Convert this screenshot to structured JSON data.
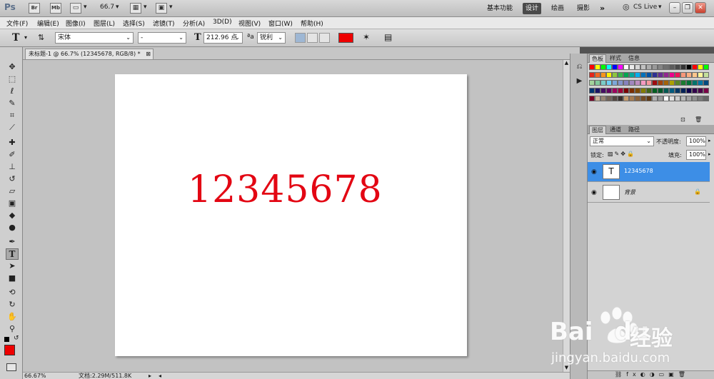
{
  "appbar": {
    "logo": "Ps",
    "bridge_icon": "Br",
    "minibridge_icon": "Mb",
    "zoom": "66.7",
    "workspaces": [
      "基本功能",
      "设计",
      "绘画",
      "摄影"
    ],
    "active_workspace": "设计",
    "more_label": "»",
    "cslive_label": "CS Live"
  },
  "menu": [
    "文件(F)",
    "编辑(E)",
    "图像(I)",
    "图层(L)",
    "选择(S)",
    "滤镜(T)",
    "分析(A)",
    "3D(D)",
    "视图(V)",
    "窗口(W)",
    "帮助(H)"
  ],
  "options": {
    "font_family": "宋体",
    "font_style": "-",
    "font_size": "212.96 点",
    "antialias_label": "ªa",
    "antialias": "锐利",
    "text_color": "#ee0000"
  },
  "document": {
    "tab_title": "未标题-1 @ 66.7% (12345678, RGB/8) *",
    "canvas_text": "12345678",
    "canvas_text_color": "#e30613",
    "status_zoom": "66.67%",
    "status_doc": "文档:2.29M/511.8K"
  },
  "panels": {
    "color_tabs": [
      "色板",
      "样式",
      "信息"
    ],
    "layers_tabs": [
      "图层",
      "通道",
      "路径"
    ],
    "blend_mode": "正常",
    "opacity_label": "不透明度:",
    "opacity": "100%",
    "lock_label": "锁定:",
    "fill_label": "填充:",
    "fill": "100%",
    "layers": [
      {
        "name": "12345678",
        "thumb": "T",
        "selected": true
      },
      {
        "name": "背景",
        "thumb": "",
        "selected": false
      }
    ]
  },
  "swatch_colors": [
    "#ff0000",
    "#ffff00",
    "#00ff00",
    "#00ffff",
    "#0000ff",
    "#ff00ff",
    "#ffffff",
    "#ebebeb",
    "#d6d6d6",
    "#c2c2c2",
    "#adadad",
    "#999999",
    "#858585",
    "#707070",
    "#5c5c5c",
    "#474747",
    "#333333",
    "#000000",
    "#ff0000",
    "#ffff00",
    "#00ff00",
    "#e4251a",
    "#f26522",
    "#f7941d",
    "#fff200",
    "#8dc63f",
    "#39b54a",
    "#00a651",
    "#00a99d",
    "#00aeef",
    "#0072bc",
    "#0054a6",
    "#2e3192",
    "#662d91",
    "#92278f",
    "#ec008c",
    "#ed145b",
    "#f7977a",
    "#fbad82",
    "#fdc68c",
    "#fff79a",
    "#c4df9b",
    "#a3d39c",
    "#82ca9c",
    "#7accc8",
    "#6dcff6",
    "#7da7d9",
    "#8393ca",
    "#8781bd",
    "#a186be",
    "#bd8cbf",
    "#f49ac1",
    "#f6989d",
    "#9e0b0f",
    "#a0410d",
    "#a36209",
    "#aba000",
    "#598527",
    "#1a7b30",
    "#007236",
    "#00746b",
    "#0076a3",
    "#004a80",
    "#003471",
    "#1b1464",
    "#440e62",
    "#630460",
    "#9e005d",
    "#9e0039",
    "#790000",
    "#7b2e00",
    "#7d4900",
    "#827b00",
    "#406618",
    "#005e20",
    "#005826",
    "#005952",
    "#005b7f",
    "#003663",
    "#002157",
    "#0d004c",
    "#32004b",
    "#4b0049",
    "#7b0046",
    "#7a0026",
    "#c7b299",
    "#998675",
    "#736357",
    "#534741",
    "#37302d",
    "#c69c6d",
    "#a67c52",
    "#8c6239",
    "#754c24",
    "#603913",
    "#b0b0b0",
    "#9a9a9a",
    "#ffffff",
    "#e0e0e0",
    "#cccccc",
    "#b8b8b8",
    "#a3a3a3",
    "#8f8f8f",
    "#7a7a7a",
    "#666666"
  ],
  "watermark": {
    "brand": "Bai",
    "brand2": "du",
    "cn": "经验",
    "url": "jingyan.baidu.com"
  }
}
